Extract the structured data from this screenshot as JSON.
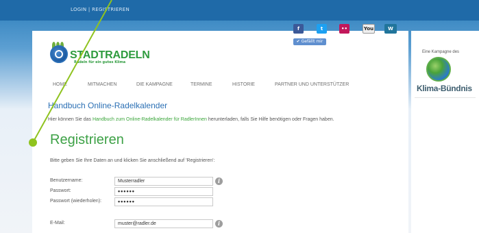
{
  "topbar": {
    "login_links": "LOGIN | REGISTRIEREN"
  },
  "social": {
    "facebook": "f",
    "twitter": "t",
    "flickr": "••",
    "youtube": "You",
    "wordpress": "W",
    "like_label": "✔ Gefällt mir"
  },
  "logo": {
    "title": "STADTRADELN",
    "tagline": "Radeln für ein gutes Klima"
  },
  "nav": {
    "items": [
      "HOME",
      "MITMACHEN",
      "DIE KAMPAGNE",
      "TERMINE",
      "HISTORIE",
      "PARTNER UND UNTERSTÜTZER"
    ]
  },
  "handbuch": {
    "title": "Handbuch Online-Radelkalender",
    "text_before": "Hier können Sie das ",
    "link_text": "Handbuch zum Online-Radelkalender für RadlerInnen",
    "text_after": " herunterladen, falls Sie Hilfe benötigen oder Fragen haben."
  },
  "register": {
    "title": "Registrieren",
    "intro": "Bitte geben Sie Ihre Daten an und klicken Sie anschließend auf 'Registrieren':",
    "fields": [
      {
        "label": "Benutzername:",
        "value": "Musterradler"
      },
      {
        "label": "Passwort:",
        "value": "••••••"
      },
      {
        "label": "Passwort (wiederholen):",
        "value": "••••••"
      },
      {
        "label": "E-Mail:",
        "value": "muster@radler.de"
      }
    ]
  },
  "sidebar": {
    "caption": "Eine Kampagne des",
    "brand": "Klima-Bündnis"
  },
  "colors": {
    "topbar": "#1f6aa8",
    "green": "#3da146",
    "link_blue": "#2a6fb4"
  }
}
